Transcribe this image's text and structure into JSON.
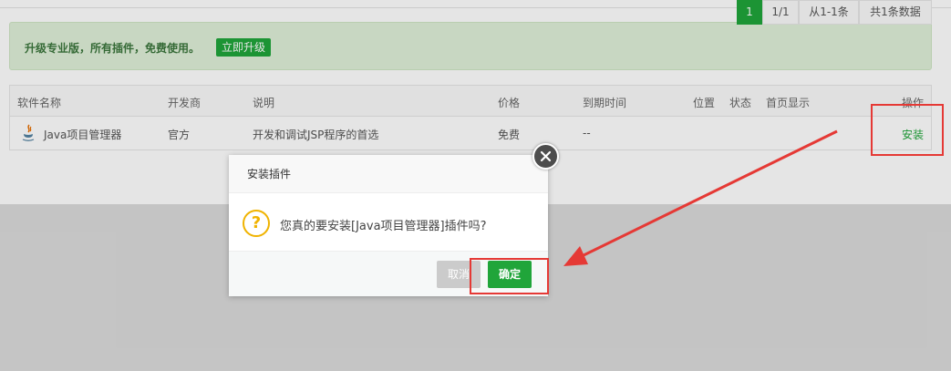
{
  "alert": {
    "text": "升级专业版，所有插件，免费使用。",
    "upgrade_button": "立即升级"
  },
  "table": {
    "headers": [
      "软件名称",
      "开发商",
      "说明",
      "价格",
      "到期时间",
      "位置",
      "状态",
      "首页显示",
      "操作"
    ],
    "row": {
      "name": "Java项目管理器",
      "developer": "官方",
      "description": "开发和调试JSP程序的首选",
      "price": "免费",
      "expire": "--",
      "action": "安装"
    }
  },
  "pagination": {
    "current": "1",
    "pages": "1/1",
    "range": "从1-1条",
    "total": "共1条数据"
  },
  "dialog": {
    "title": "安装插件",
    "message": "您真的要安装[Java项目管理器]插件吗?",
    "cancel": "取消",
    "confirm": "确定"
  },
  "colors": {
    "accent": "#20a53a",
    "annotation": "#e53935",
    "warning": "#f0b300"
  },
  "icons": [
    "java-icon",
    "question-icon",
    "close-icon",
    "arrow-annotation"
  ]
}
